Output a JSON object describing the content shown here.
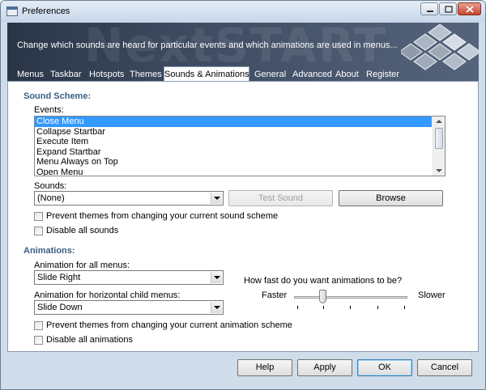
{
  "window": {
    "title": "Preferences",
    "controls": [
      "minimize",
      "maximize",
      "close"
    ]
  },
  "banner": {
    "description": "Change which sounds are heard for particular events and which animations are used in menus...",
    "watermark": "NextSTART"
  },
  "tabs": [
    {
      "label": "Menus",
      "active": false
    },
    {
      "label": "Taskbar",
      "active": false
    },
    {
      "label": "Hotspots",
      "active": false
    },
    {
      "label": "Themes",
      "active": false
    },
    {
      "label": "Sounds & Animations",
      "active": true
    },
    {
      "label": "General",
      "active": false
    },
    {
      "label": "Advanced",
      "active": false
    },
    {
      "label": "About",
      "active": false
    },
    {
      "label": "Register",
      "active": false
    }
  ],
  "sound_scheme": {
    "heading": "Sound Scheme:",
    "events_label": "Events:",
    "events": [
      "Close Menu",
      "Collapse Startbar",
      "Execute Item",
      "Expand Startbar",
      "Menu Always on Top",
      "Open Menu"
    ],
    "selected_event": "Close Menu",
    "sounds_label": "Sounds:",
    "sound_value": "(None)",
    "test_sound_label": "Test Sound",
    "browse_label": "Browse",
    "prevent_label": "Prevent themes from changing your current sound scheme",
    "prevent_checked": false,
    "disable_label": "Disable all sounds",
    "disable_checked": false
  },
  "animations": {
    "heading": "Animations:",
    "all_menus_label": "Animation for all menus:",
    "all_menus_value": "Slide Right",
    "horizontal_label": "Animation for horizontal child menus:",
    "horizontal_value": "Slide Down",
    "speed_question": "How fast do you want animations to be?",
    "faster_label": "Faster",
    "slower_label": "Slower",
    "speed_level": 0.25,
    "prevent_label": "Prevent themes from changing your current animation scheme",
    "prevent_checked": false,
    "disable_label": "Disable all animations",
    "disable_checked": false
  },
  "footer": {
    "help_label": "Help",
    "apply_label": "Apply",
    "ok_label": "OK",
    "cancel_label": "Cancel"
  },
  "colors": {
    "accent": "#3399ff",
    "section_heading": "#3c5f86",
    "banner_bg": "#2a3547"
  }
}
